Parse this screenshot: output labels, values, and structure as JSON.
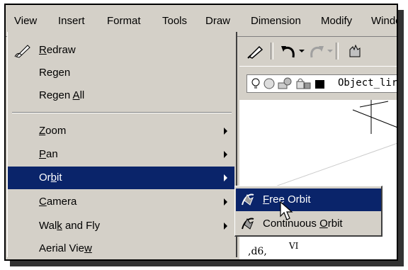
{
  "menubar": {
    "items": [
      "View",
      "Insert",
      "Format",
      "Tools",
      "Draw",
      "Dimension",
      "Modify",
      "Windo"
    ]
  },
  "view_menu": {
    "items": [
      {
        "pre": "",
        "ul": "R",
        "post": "edraw"
      },
      {
        "pre": "Re",
        "ul": "g",
        "post": "en"
      },
      {
        "pre": "Regen ",
        "ul": "A",
        "post": "ll"
      },
      {
        "pre": "",
        "ul": "Z",
        "post": "oom"
      },
      {
        "pre": "",
        "ul": "P",
        "post": "an"
      },
      {
        "pre": "Or",
        "ul": "b",
        "post": "it"
      },
      {
        "pre": "",
        "ul": "C",
        "post": "amera"
      },
      {
        "pre": "Wal",
        "ul": "k",
        "post": " and Fly"
      },
      {
        "pre": "Aerial Vie",
        "ul": "w",
        "post": ""
      }
    ]
  },
  "orbit_submenu": {
    "items": [
      {
        "pre": "",
        "ul": "F",
        "post": "ree Orbit"
      },
      {
        "pre": "Continuous ",
        "ul": "O",
        "post": "rbit"
      }
    ]
  },
  "layer": {
    "name": "Object_lir"
  },
  "colors": {
    "menu_bg": "#d4d0c8",
    "highlight": "#0a246a",
    "shadow": "#333333"
  }
}
